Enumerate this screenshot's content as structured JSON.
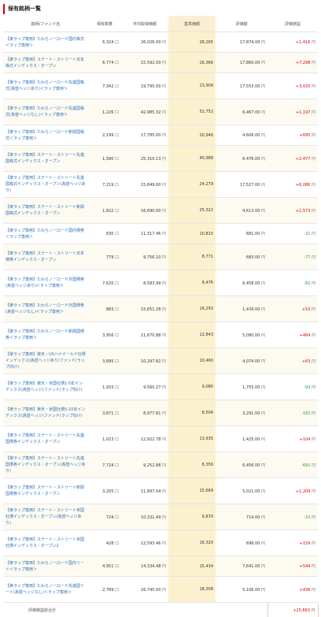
{
  "section_title": "保有銘柄一覧",
  "columns": {
    "name": "銘柄/ファンド名",
    "qty": "保有数量",
    "avg_price": "平均取得価額",
    "price": "基準価額",
    "value": "評価額",
    "gain": "評価損益"
  },
  "units": {
    "qty": "口",
    "yen": "円"
  },
  "rows": [
    {
      "name": "【楽ラップ専用】たわらノーロード国内株式＜ラップ専用＞",
      "qty": "6,324",
      "avg": "26,026.00",
      "price": "28,265",
      "value": "17,874.00",
      "gain": "+1,416",
      "sign": "pos",
      "tall": false
    },
    {
      "name": "【楽ラップ専用】ステート・ストリート日本株式インデックス・オープン",
      "qty": "6,774",
      "avg": "15,592.00",
      "price": "26,366",
      "value": "17,860.00",
      "gain": "+7,298",
      "sign": "pos",
      "tall": false
    },
    {
      "name": "【楽ラップ専用】たわらノーロード先進国株式(為替ヘッジあり)＜ラップ専用＞",
      "qty": "7,342",
      "avg": "19,795.00",
      "price": "23,909",
      "value": "17,553.00",
      "gain": "+3,020",
      "sign": "pos",
      "tall": true
    },
    {
      "name": "【楽ラップ専用】たわらノーロード先進国株式(為替ヘッジなし)＜ラップ専用＞",
      "qty": "1,226",
      "avg": "42,985.32",
      "price": "52,752",
      "value": "6,467.00",
      "gain": "+1,197",
      "sign": "pos",
      "tall": true
    },
    {
      "name": "【楽ラップ専用】たわらノーロード新興国株式＜ラップ専用＞",
      "qty": "2,199",
      "avg": "17,785.00",
      "price": "20,946",
      "value": "4,606.00",
      "gain": "+695",
      "sign": "pos",
      "tall": false
    },
    {
      "name": "【楽ラップ専用】ステート・ストリート先進国株式インデックス・オープン",
      "qty": "1,580",
      "avg": "25,310.13",
      "price": "40,988",
      "value": "6,476.00",
      "gain": "+2,477",
      "sign": "pos",
      "tall": true
    },
    {
      "name": "【楽ラップ専用】ステート・ストリート先進国株式インデックス・オープン(為替ヘッジあり)",
      "qty": "7,219",
      "avg": "15,849.00",
      "price": "24,279",
      "value": "17,527.00",
      "gain": "+6,086",
      "sign": "pos",
      "tall": true
    },
    {
      "name": "【楽ラップ専用】ステート・ストリート新興国株式インデックス・オープン",
      "qty": "1,822",
      "avg": "16,690.00",
      "price": "25,322",
      "value": "4,613.00",
      "gain": "+1,573",
      "sign": "pos",
      "tall": true
    },
    {
      "name": "【楽ラップ専用】たわらノーロード国内債券＜ラップ専用＞",
      "qty": "630",
      "avg": "11,317.46",
      "price": "10,815",
      "value": "681.00",
      "gain": "-32",
      "sign": "neg",
      "tall": false
    },
    {
      "name": "【楽ラップ専用】ステート・ストリート日本債券インデックス・オープン",
      "qty": "779",
      "avg": "9,756.10",
      "price": "8,771",
      "value": "683.00",
      "gain": "-77",
      "sign": "neg",
      "tall": true
    },
    {
      "name": "【楽ラップ専用】たわらノーロード外国債券(為替ヘッジあり)＜ラップ専用＞",
      "qty": "7,620",
      "avg": "8,583.99",
      "price": "8,476",
      "value": "6,458.00",
      "gain": "-82",
      "sign": "neg",
      "tall": true
    },
    {
      "name": "【楽ラップ専用】たわらノーロード外国債券(為替ヘッジなし)＜ラップ専用＞",
      "qty": "883",
      "avg": "15,651.28",
      "price": "16,250",
      "value": "1,434.00",
      "gain": "+53",
      "sign": "pos",
      "tall": true
    },
    {
      "name": "【楽ラップ専用】たわらノーロード新興国債券＜ラップ専用＞",
      "qty": "3,956",
      "avg": "11,670.88",
      "price": "12,843",
      "value": "5,080.00",
      "gain": "+464",
      "sign": "pos",
      "tall": true
    },
    {
      "name": "【楽ラップ専用】楽天・USハイイールド社債インデックス(為替ヘッジあり)ファンド(ラップ向け)",
      "qty": "3,895",
      "avg": "10,297.82",
      "price": "10,460",
      "value": "4,074.00",
      "gain": "+63",
      "sign": "pos",
      "tall": true
    },
    {
      "name": "【楽ラップ専用】楽天・米国社債1-5年インデックス(為替ヘッジ)ファンド(ラップ向け)",
      "qty": "1,933",
      "avg": "9,560.27",
      "price": "9,080",
      "value": "1,755.00",
      "gain": "-93",
      "sign": "neg",
      "tall": true
    },
    {
      "name": "【楽ラップ専用】楽天・米国社債5-10年インデックス(為替ヘッジ)ファンド(ラップ向け)",
      "qty": "3,871",
      "avg": "8,977.81",
      "price": "8,504",
      "value": "3,291.00",
      "gain": "-183",
      "sign": "neg",
      "tall": true
    },
    {
      "name": "【楽ラップ専用】ステート・ストリート先進国債券インデックス・オープン",
      "qty": "1,023",
      "avg": "12,922.78",
      "price": "13,935",
      "value": "1,425.00",
      "gain": "+104",
      "sign": "pos",
      "tall": true
    },
    {
      "name": "【楽ラップ専用】ステート・ストリート先進国債券インデックス・オープン(為替ヘッジあり)",
      "qty": "7,724",
      "avg": "9,252.88",
      "price": "8,359",
      "value": "6,456.00",
      "gain": "-691",
      "sign": "neg",
      "tall": true
    },
    {
      "name": "【楽ラップ専用】ステート・ストリート新興国債券インデックス・オープン",
      "qty": "3,205",
      "avg": "11,897.04",
      "price": "15,669",
      "value": "5,021.00",
      "gain": "+1,209",
      "sign": "pos",
      "tall": true
    },
    {
      "name": "【楽ラップ専用】ステート・ストリート米国社債インデックス・オープン(為替ヘッジあり)",
      "qty": "724",
      "avg": "10,331.49",
      "price": "9,870",
      "value": "714.00",
      "gain": "-33",
      "sign": "neg",
      "tall": true
    },
    {
      "name": "【楽ラップ専用】ステート・ストリート米国社債インデックス・オープン2",
      "qty": "428",
      "avg": "12,593.46",
      "price": "16,320",
      "value": "698.00",
      "gain": "+159",
      "sign": "pos",
      "tall": true
    },
    {
      "name": "【楽ラップ専用】たわらノーロード国内リート＜ラップ専用＞",
      "qty": "4,951",
      "avg": "14,334.48",
      "price": "15,434",
      "value": "7,641.00",
      "gain": "+544",
      "sign": "pos",
      "tall": false
    },
    {
      "name": "【楽ラップ専用】たわらノーロード先進国リート(為替ヘッジなし)＜ラップ専用＞",
      "qty": "2,789",
      "avg": "16,745.00",
      "price": "18,308",
      "value": "5,106.00",
      "gain": "+436",
      "sign": "pos",
      "tall": true
    }
  ],
  "total": {
    "label": "評価損益総合計",
    "value": "+25,663"
  },
  "colors": {
    "accent_red": "#d40000",
    "negative_green": "#2e9b2e",
    "highlight_column": "#fbf1cf",
    "link_blue": "#2a6fba"
  }
}
